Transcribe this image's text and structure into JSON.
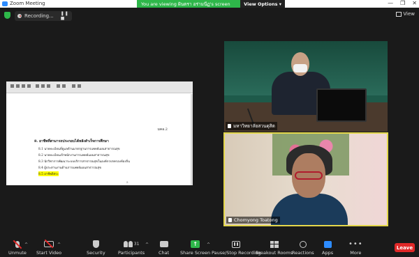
{
  "window": {
    "title": "Zoom Meeting",
    "controls": [
      "—",
      "❐",
      "✕"
    ]
  },
  "share_banner": {
    "text": "You are viewing ฝันตรา อร่ามนีฏ's screen",
    "view_options": "View Options ▾"
  },
  "recording": {
    "label": "Recording...",
    "controls": "❚❚ ■"
  },
  "view": {
    "label": "View"
  },
  "document": {
    "page_number": "มคอ.2",
    "heading": "8.   อาชีพที่สามารถประกอบได้หลังสำเร็จการศึกษา",
    "items": [
      "8.1   นายทะเบียนที่ดูแลด้านมาตรฐานการแพทย์แผนสาธารณสุข",
      "8.2   นายทะเบียนเจ้าพนักงานการแพทย์แผนสาธารณสุข",
      "8.3   นักวิชาการพัฒนาระบบบริการสาธารณสุขในองค์กรปกครองท้องถิ่น",
      "8.4   ผู้ประสานงานด้านการแพทย์แผนสาธารณสุข",
      "8.5   อาชีพอิสระ"
    ],
    "page_mark": "5"
  },
  "participants": {
    "host_name": "มหาวิทยาลัยสวนดุสิต",
    "guest_name": "Chomyong Toatong"
  },
  "toolbar": {
    "unmute": "Unmute",
    "start_video": "Start Video",
    "security": "Security",
    "participants": "Participants",
    "participants_count": "31",
    "chat": "Chat",
    "share_screen": "Share Screen",
    "share_glyph": "↑",
    "pause_recording": "Pause/Stop Recording",
    "breakout_rooms": "Breakout Rooms",
    "reactions": "Reactions",
    "apps": "Apps",
    "more": "More",
    "more_glyph": "•••",
    "leave": "Leave"
  },
  "colors": {
    "banner_green": "#2eb74a",
    "leave_red": "#e02828",
    "active_speaker_border": "#e4d74b",
    "highlight_yellow": "#ffff00"
  }
}
